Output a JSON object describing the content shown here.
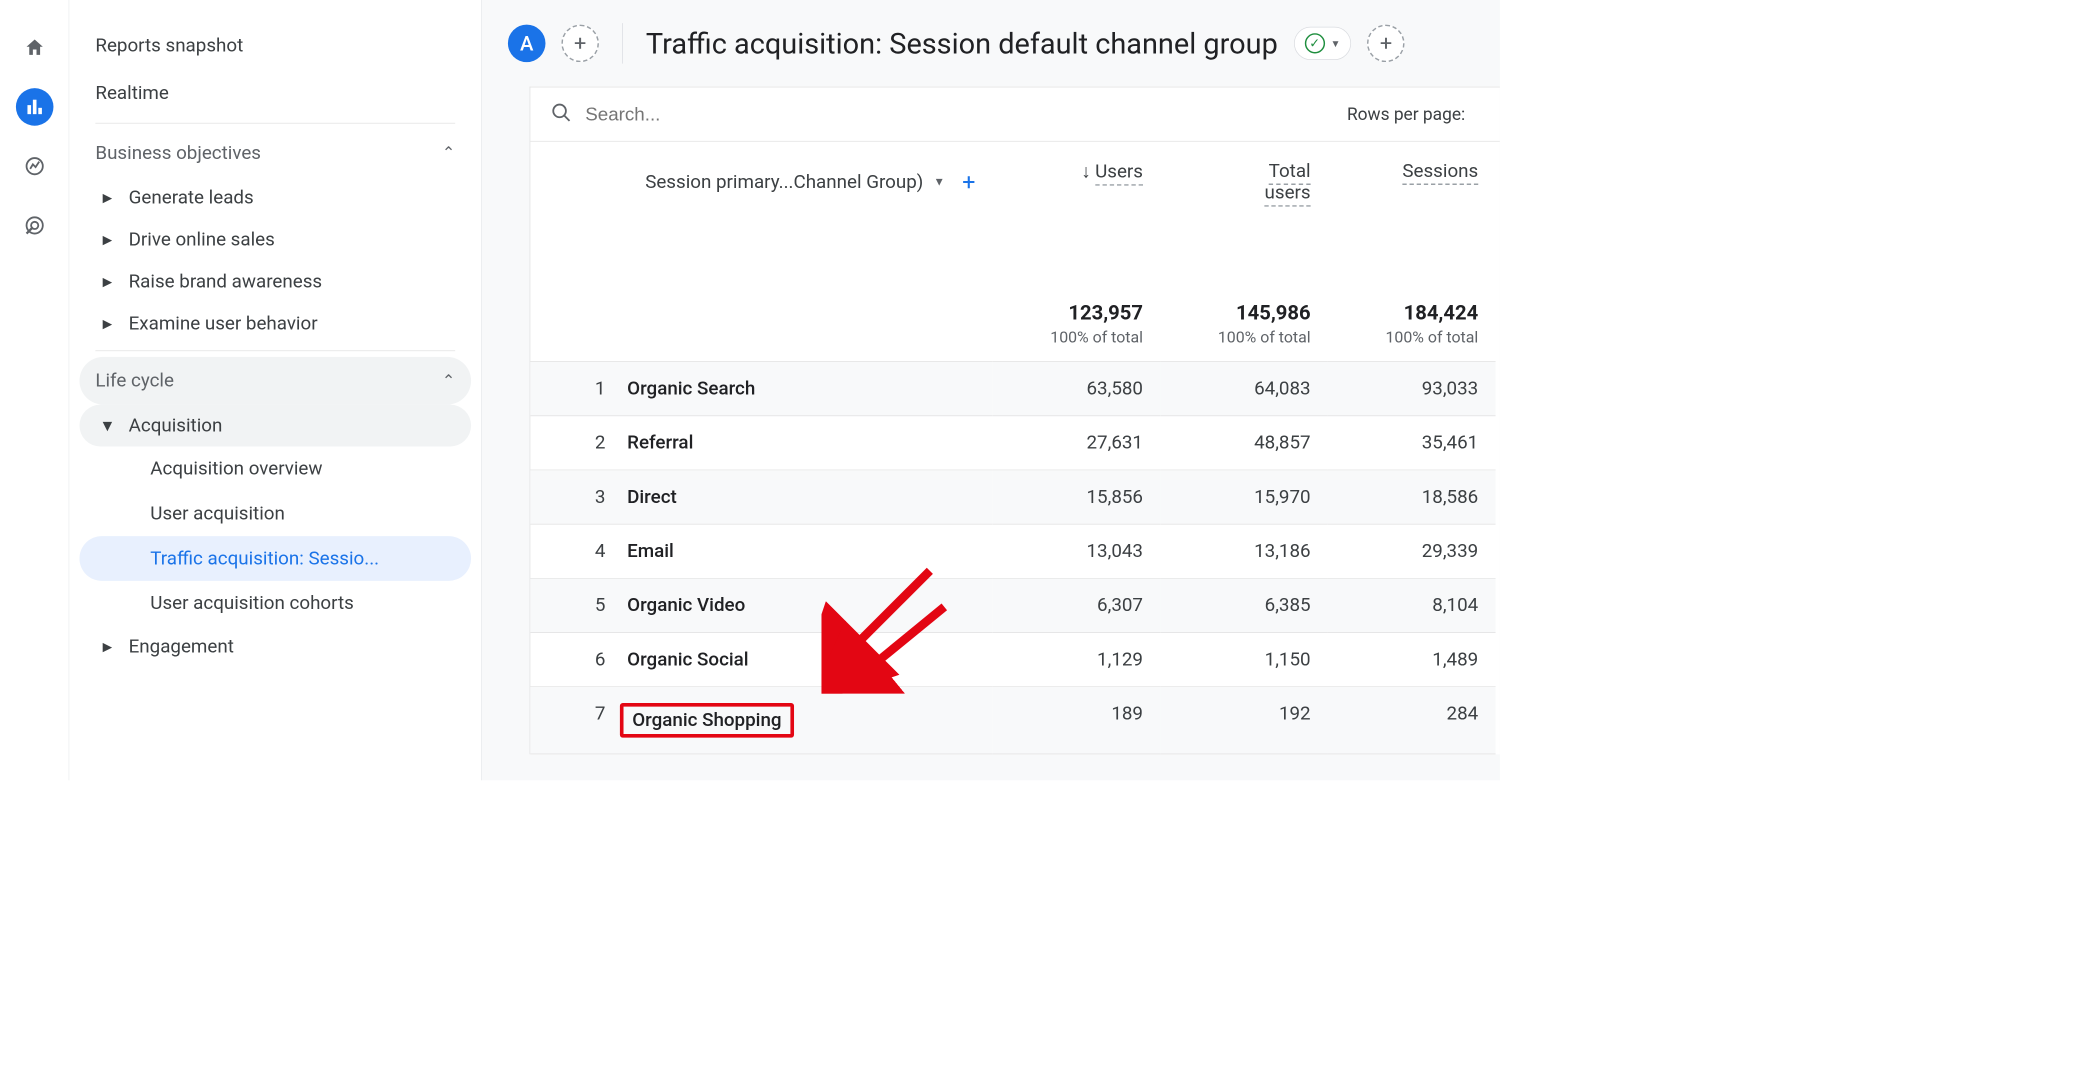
{
  "rail": {
    "home": "home-icon",
    "reports": "reports-icon",
    "explore": "explore-icon",
    "advertising": "advertising-icon"
  },
  "sidebar": {
    "snapshot": "Reports snapshot",
    "realtime": "Realtime",
    "group_bo": "Business objectives",
    "bo_items": [
      "Generate leads",
      "Drive online sales",
      "Raise brand awareness",
      "Examine user behavior"
    ],
    "group_lc": "Life cycle",
    "acquisition": "Acquisition",
    "acq_items": [
      "Acquisition overview",
      "User acquisition",
      "Traffic acquisition: Sessio...",
      "User acquisition cohorts"
    ],
    "engagement": "Engagement"
  },
  "header": {
    "avatar": "A",
    "title": "Traffic acquisition: Session default channel group"
  },
  "search": {
    "placeholder": "Search..."
  },
  "rpp_label": "Rows per page:",
  "dim_header": "Session primary...Channel Group)",
  "metrics": [
    {
      "label": "Users",
      "sorted": true
    },
    {
      "label": "Total users",
      "sorted": false,
      "two_line": true
    },
    {
      "label": "Sessions",
      "sorted": false
    }
  ],
  "totals": {
    "users": "123,957",
    "total_users": "145,986",
    "sessions": "184,424",
    "pct": "100% of total"
  },
  "rows": [
    {
      "i": "1",
      "label": "Organic Search",
      "users": "63,580",
      "total_users": "64,083",
      "sessions": "93,033"
    },
    {
      "i": "2",
      "label": "Referral",
      "users": "27,631",
      "total_users": "48,857",
      "sessions": "35,461"
    },
    {
      "i": "3",
      "label": "Direct",
      "users": "15,856",
      "total_users": "15,970",
      "sessions": "18,586"
    },
    {
      "i": "4",
      "label": "Email",
      "users": "13,043",
      "total_users": "13,186",
      "sessions": "29,339"
    },
    {
      "i": "5",
      "label": "Organic Video",
      "users": "6,307",
      "total_users": "6,385",
      "sessions": "8,104"
    },
    {
      "i": "6",
      "label": "Organic Social",
      "users": "1,129",
      "total_users": "1,150",
      "sessions": "1,489"
    },
    {
      "i": "7",
      "label": "Organic Shopping",
      "users": "189",
      "total_users": "192",
      "sessions": "284",
      "highlight": true
    }
  ]
}
